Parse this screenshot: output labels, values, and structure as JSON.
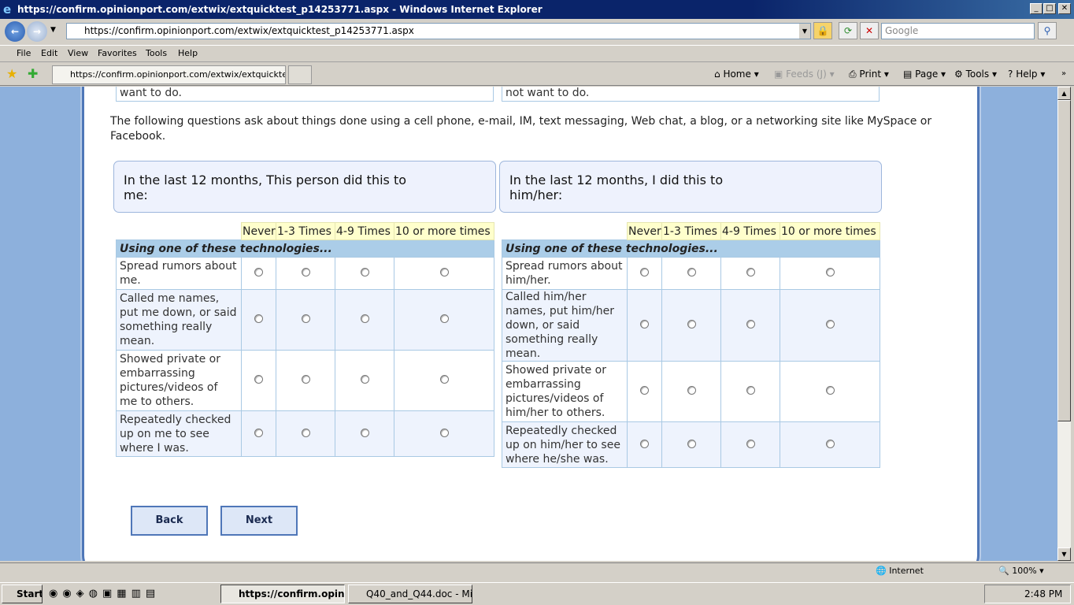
{
  "window": {
    "title": "https://confirm.opinionport.com/extwix/extquicktest_p14253771.aspx - Windows Internet Explorer",
    "minimize": "_",
    "maximize": "□",
    "close": "✕"
  },
  "toolbar": {
    "back": "←",
    "forward": "→",
    "address": "https://confirm.opinionport.com/extwix/extquicktest_p14253771.aspx",
    "search_placeholder": "Google",
    "search_icon": "search-icon"
  },
  "menu": [
    "File",
    "Edit",
    "View",
    "Favorites",
    "Tools",
    "Help"
  ],
  "tab": {
    "title": "https://confirm.opinionport.com/extwix/extquicktest_..."
  },
  "commands": {
    "home": "Home",
    "feeds": "Feeds (J)",
    "print": "Print",
    "page": "Page",
    "tools": "Tools",
    "help": "Help"
  },
  "survey": {
    "partial_left": "want to do.",
    "partial_right": "not want to do.",
    "intro": "The following questions ask about things done using a cell phone, e-mail, IM, text messaging, Web chat, a blog, or a networking site like MySpace or Facebook.",
    "options": [
      "Never",
      "1-3 Times",
      "4-9 Times",
      "10 or more times"
    ],
    "left": {
      "heading": "In the last 12 months, This person did this to me:",
      "category": "Using one of these technologies...",
      "rows": [
        "Spread rumors about me.",
        "Called me names, put me down, or said something really mean.",
        "Showed private or embarrassing pictures/videos of me to others.",
        "Repeatedly checked up on me to see where I was."
      ]
    },
    "right": {
      "heading": "In the last 12 months, I did this to him/her:",
      "category": "Using one of these technologies...",
      "rows": [
        "Spread rumors about him/her.",
        "Called him/her names, put him/her down, or said something really mean.",
        "Showed private or embarrassing pictures/videos of him/her to others.",
        "Repeatedly checked up on him/her to see where he/she was."
      ]
    },
    "back": "Back",
    "next": "Next"
  },
  "status": {
    "zone": "Internet",
    "zoom": "100%"
  },
  "taskbar": {
    "start": "Start",
    "tasks": [
      "https://confirm.opini...",
      "Q40_and_Q44.doc - Micr..."
    ],
    "time": "2:48 PM"
  },
  "colors": {
    "page_bg": "#8db0dc",
    "header_yellow": "#ffffcc",
    "category_blue": "#abcde8",
    "card_border": "#4f77b8"
  }
}
